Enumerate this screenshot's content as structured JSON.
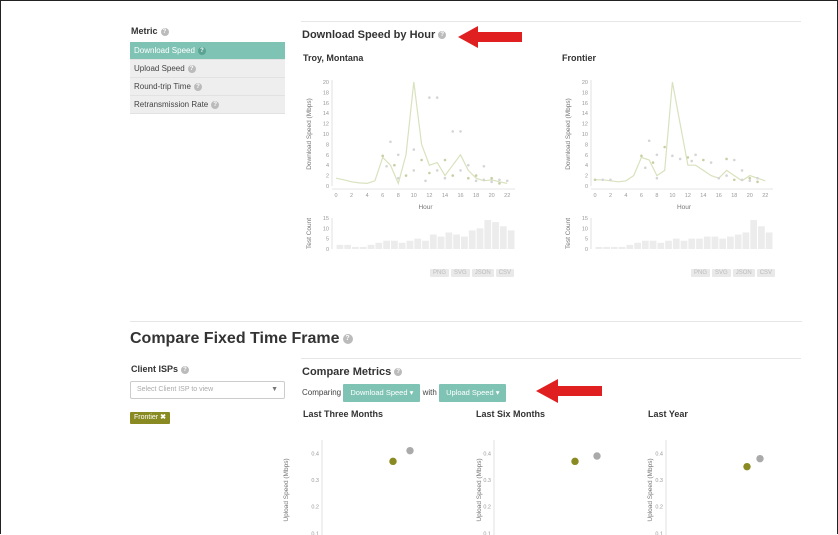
{
  "sidebar": {
    "title": "Metric",
    "items": [
      {
        "label": "Download Speed"
      },
      {
        "label": "Upload Speed"
      },
      {
        "label": "Round-trip Time"
      },
      {
        "label": "Retransmission Rate"
      }
    ]
  },
  "hour_section": {
    "title": "Download Speed by Hour",
    "export_buttons": [
      "PNG",
      "SVG",
      "JSON",
      "CSV"
    ]
  },
  "compare": {
    "title": "Compare Fixed Time Frame",
    "client_isps_label": "Client ISPs",
    "isp_select_placeholder": "Select Client ISP to view",
    "selected_isp": "Frontier",
    "metrics_title": "Compare Metrics",
    "comparing_label": "Comparing",
    "with_label": "with",
    "metric_a": "Download Speed",
    "metric_b": "Upload Speed"
  },
  "colors": {
    "accent": "#7fc3b5",
    "olive": "#8a8a22",
    "arrow": "#e02020",
    "gray_point": "#aaaaaa"
  },
  "chart_data": [
    {
      "type": "line",
      "title": "Troy, Montana",
      "xlabel": "Hour",
      "ylabel": "Download Speed (Mbps)",
      "xlim": [
        0,
        23
      ],
      "ylim": [
        0,
        20
      ],
      "xticks": [
        0,
        2,
        4,
        6,
        8,
        10,
        12,
        14,
        16,
        18,
        20,
        22
      ],
      "yticks": [
        0,
        2,
        4,
        6,
        8,
        10,
        12,
        14,
        16,
        18,
        20
      ],
      "line": {
        "x": [
          0,
          1,
          2,
          3,
          4,
          5,
          6,
          7,
          8,
          9,
          10,
          11,
          12,
          13,
          14,
          15,
          16,
          17,
          18,
          19,
          20,
          21,
          22
        ],
        "y": [
          1.5,
          1.2,
          0.8,
          0.6,
          0.5,
          1,
          5.5,
          4,
          0.5,
          6,
          20,
          8,
          4,
          4.5,
          2,
          4,
          6,
          3,
          1.5,
          1,
          1.2,
          0.8,
          0.5
        ]
      },
      "scatter": {
        "x": [
          6,
          6.5,
          7,
          7.5,
          8,
          8,
          9,
          10,
          10,
          11,
          11.5,
          12,
          12,
          13,
          13,
          14,
          14,
          15,
          15,
          16,
          16,
          17,
          17,
          18,
          18,
          19,
          19,
          20,
          20,
          21,
          21,
          22
        ],
        "y": [
          5.8,
          3.8,
          8.5,
          4,
          6,
          1.5,
          2,
          7,
          3,
          5,
          1,
          17,
          2.5,
          17,
          3,
          5,
          1.5,
          10.5,
          2,
          10.5,
          3,
          1.5,
          4,
          1,
          2,
          1.2,
          3.8,
          1.5,
          0.8,
          1.2,
          0.5,
          1
        ]
      },
      "histogram": {
        "ylabel": "Test Count",
        "yticks": [
          0,
          5,
          10,
          15
        ],
        "ylim": [
          0,
          15
        ],
        "values": [
          2,
          2,
          1,
          1,
          2,
          3,
          4,
          4,
          3,
          4,
          5,
          4,
          7,
          6,
          8,
          7,
          6,
          9,
          10,
          14,
          13,
          11,
          9
        ]
      }
    },
    {
      "type": "line",
      "title": "Frontier",
      "xlabel": "Hour",
      "ylabel": "Download Speed (Mbps)",
      "xlim": [
        0,
        23
      ],
      "ylim": [
        0,
        20
      ],
      "xticks": [
        0,
        2,
        4,
        6,
        8,
        10,
        12,
        14,
        16,
        18,
        20,
        22
      ],
      "yticks": [
        0,
        2,
        4,
        6,
        8,
        10,
        12,
        14,
        16,
        18,
        20
      ],
      "line": {
        "x": [
          0,
          1,
          2,
          3,
          4,
          5,
          6,
          7,
          8,
          9,
          10,
          11,
          12,
          13,
          14,
          15,
          16,
          17,
          18,
          19,
          20,
          21,
          22
        ],
        "y": [
          1.2,
          1.2,
          1,
          0.8,
          1,
          2,
          5.5,
          5,
          2,
          3,
          20,
          12,
          4,
          4,
          3,
          2,
          1.5,
          3,
          2,
          1,
          2,
          1.5,
          1
        ]
      },
      "scatter": {
        "x": [
          0,
          1,
          2,
          6,
          6.5,
          7,
          7.5,
          8,
          8,
          9,
          10,
          11,
          12,
          12.5,
          13,
          14,
          15,
          16,
          17,
          17,
          18,
          18,
          19,
          19,
          20,
          20,
          21,
          21
        ],
        "y": [
          1.2,
          1.2,
          1.2,
          5.8,
          3.5,
          8.7,
          4.5,
          6,
          1.5,
          7.5,
          5.8,
          5.2,
          5.5,
          4.8,
          6,
          5,
          4.5,
          1.5,
          5.2,
          2,
          5,
          1.2,
          3,
          1.2,
          1.5,
          1,
          1.5,
          0.8
        ]
      },
      "histogram": {
        "ylabel": "Test Count",
        "yticks": [
          0,
          5,
          10,
          15
        ],
        "ylim": [
          0,
          15
        ],
        "values": [
          1,
          1,
          1,
          1,
          2,
          3,
          4,
          4,
          3,
          4,
          5,
          4,
          5,
          5,
          6,
          6,
          5,
          6,
          7,
          8,
          14,
          11,
          8
        ]
      }
    },
    {
      "type": "scatter",
      "title": "Last Three Months",
      "ylabel": "Upload Speed (Mbps)",
      "yticks": [
        0.1,
        0.2,
        0.3,
        0.4
      ],
      "ylim": [
        0,
        0.45
      ],
      "points": [
        {
          "group": "olive",
          "y": 0.37
        },
        {
          "group": "gray",
          "y": 0.41
        }
      ]
    },
    {
      "type": "scatter",
      "title": "Last Six Months",
      "ylabel": "Upload Speed (Mbps)",
      "yticks": [
        0.1,
        0.2,
        0.3,
        0.4
      ],
      "ylim": [
        0,
        0.45
      ],
      "points": [
        {
          "group": "olive",
          "y": 0.37
        },
        {
          "group": "gray",
          "y": 0.39
        }
      ]
    },
    {
      "type": "scatter",
      "title": "Last Year",
      "ylabel": "Upload Speed (Mbps)",
      "yticks": [
        0.1,
        0.2,
        0.3,
        0.4
      ],
      "ylim": [
        0,
        0.45
      ],
      "points": [
        {
          "group": "olive",
          "y": 0.35
        },
        {
          "group": "gray",
          "y": 0.38
        }
      ]
    }
  ]
}
